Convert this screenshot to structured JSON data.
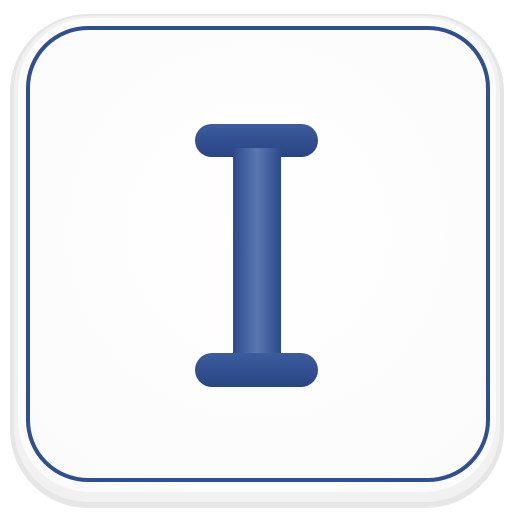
{
  "icon": {
    "name": "instapaper-app-icon",
    "glyph": "I",
    "colors": {
      "background": "#ffffff",
      "border": "#2f4f94",
      "glyph_dark": "#2c4a8c",
      "glyph_mid": "#5b78b3",
      "shadow": "#d9d9d9"
    }
  }
}
